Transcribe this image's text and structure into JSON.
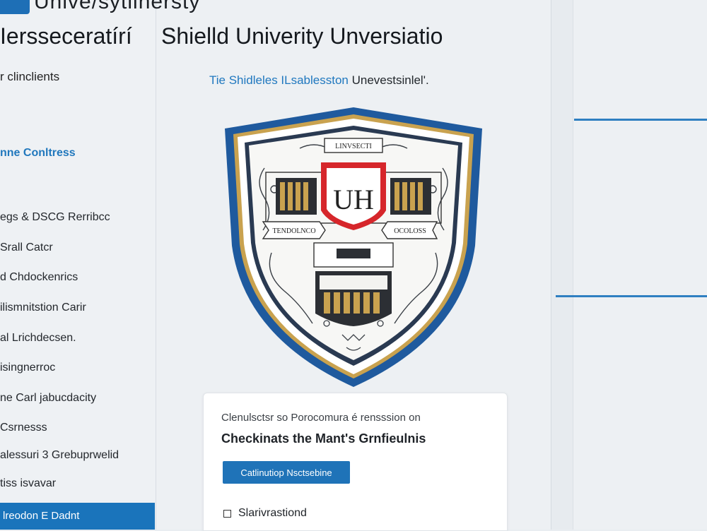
{
  "app": {
    "title": "Unive/sytiinersty"
  },
  "header": {
    "left_title": "Iersseceratírí",
    "main_title": "Shielld Univerity Unversiatio"
  },
  "sidebar": {
    "heading": "r clinclients",
    "section": "nne Conltress",
    "items": [
      {
        "label": "egs & DSCG Rerribcc"
      },
      {
        "label": "Srall Catcr"
      },
      {
        "label": "d Chdockenrics"
      },
      {
        "label": "ilismnitstion Carir"
      },
      {
        "label": "al Lrichdecsen."
      },
      {
        "label": "isingnerroc"
      },
      {
        "label": "ne Carl jabucdacity"
      },
      {
        "label": "Csrnesss"
      },
      {
        "label": "alessuri 3 Grebuprwelid"
      },
      {
        "label": "tiss isvavar"
      }
    ],
    "active_item": "lreodon E Dadnt"
  },
  "shield": {
    "caption_blue": "Tie Shidleles ILsablesston",
    "caption_dark": " Unevestsinlel'.",
    "crest_top_text": "LINVSECTI",
    "crest_center_text": "UH",
    "crest_left_banner": "TENDOLNCO",
    "crest_right_banner": "OCOLOSS"
  },
  "card": {
    "subtitle": "Clenulsctsr so Porocomura é rensssion on",
    "title": "Checkinats the Mant's Grnfieulnis",
    "button_label": "Catlinutiop Nsctsebine",
    "checkbox_label": "Slarivrastiond",
    "checkbox_checked": false
  },
  "colors": {
    "accent": "#1f73b8",
    "shield_blue": "#1f5a9e",
    "shield_gold": "#c9a24f",
    "shield_red": "#d6262b"
  }
}
